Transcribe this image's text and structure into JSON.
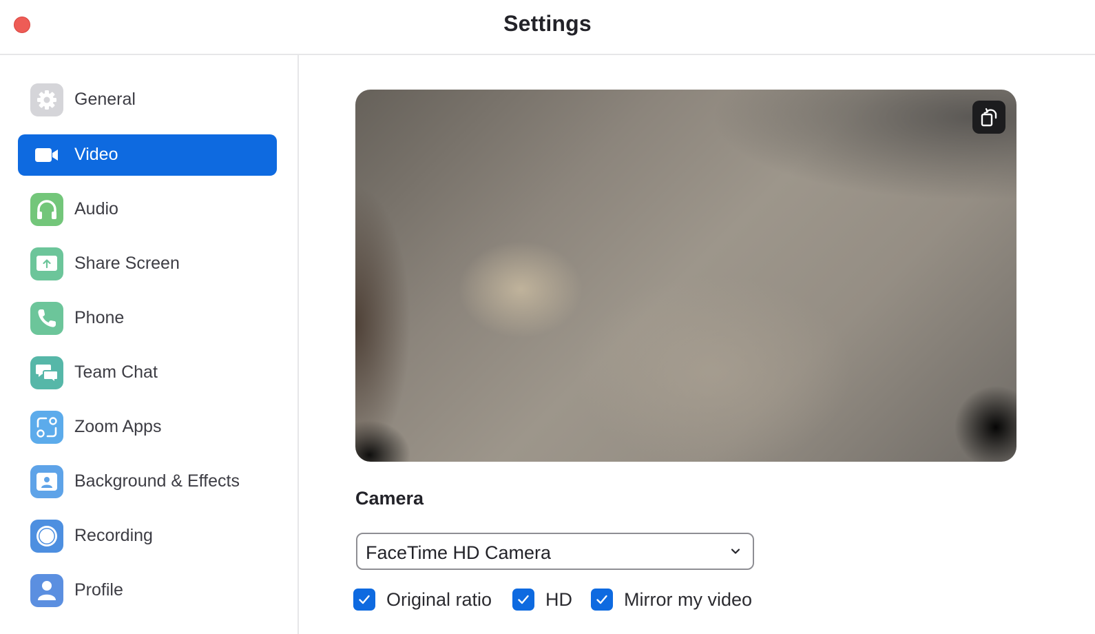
{
  "window": {
    "title": "Settings"
  },
  "sidebar": {
    "items": [
      {
        "label": "General",
        "icon": "gear-icon",
        "color": "#d5d5d9",
        "active": false
      },
      {
        "label": "Video",
        "icon": "video-camera-icon",
        "color": "#0e6ae0",
        "active": true
      },
      {
        "label": "Audio",
        "icon": "headphones-icon",
        "color": "#73c67a",
        "active": false
      },
      {
        "label": "Share Screen",
        "icon": "share-screen-icon",
        "color": "#6cc59a",
        "active": false
      },
      {
        "label": "Phone",
        "icon": "phone-icon",
        "color": "#6cc59a",
        "active": false
      },
      {
        "label": "Team Chat",
        "icon": "chat-bubbles-icon",
        "color": "#56b7a8",
        "active": false
      },
      {
        "label": "Zoom Apps",
        "icon": "zoom-apps-icon",
        "color": "#5cabeb",
        "active": false
      },
      {
        "label": "Background & Effects",
        "icon": "background-effects-icon",
        "color": "#5ea3e8",
        "active": false
      },
      {
        "label": "Recording",
        "icon": "recording-icon",
        "color": "#4d8fe0",
        "active": false
      },
      {
        "label": "Profile",
        "icon": "profile-icon",
        "color": "#5b8fe0",
        "active": false
      }
    ]
  },
  "main": {
    "preview_button_icon": "rotate-camera-icon",
    "camera_section_title": "Camera",
    "camera_select_value": "FaceTime HD Camera",
    "options": [
      {
        "label": "Original ratio",
        "checked": true
      },
      {
        "label": "HD",
        "checked": true
      },
      {
        "label": "Mirror my video",
        "checked": true
      }
    ]
  },
  "colors": {
    "accent": "#0e6ae0",
    "close_button": "#ee5c56"
  }
}
